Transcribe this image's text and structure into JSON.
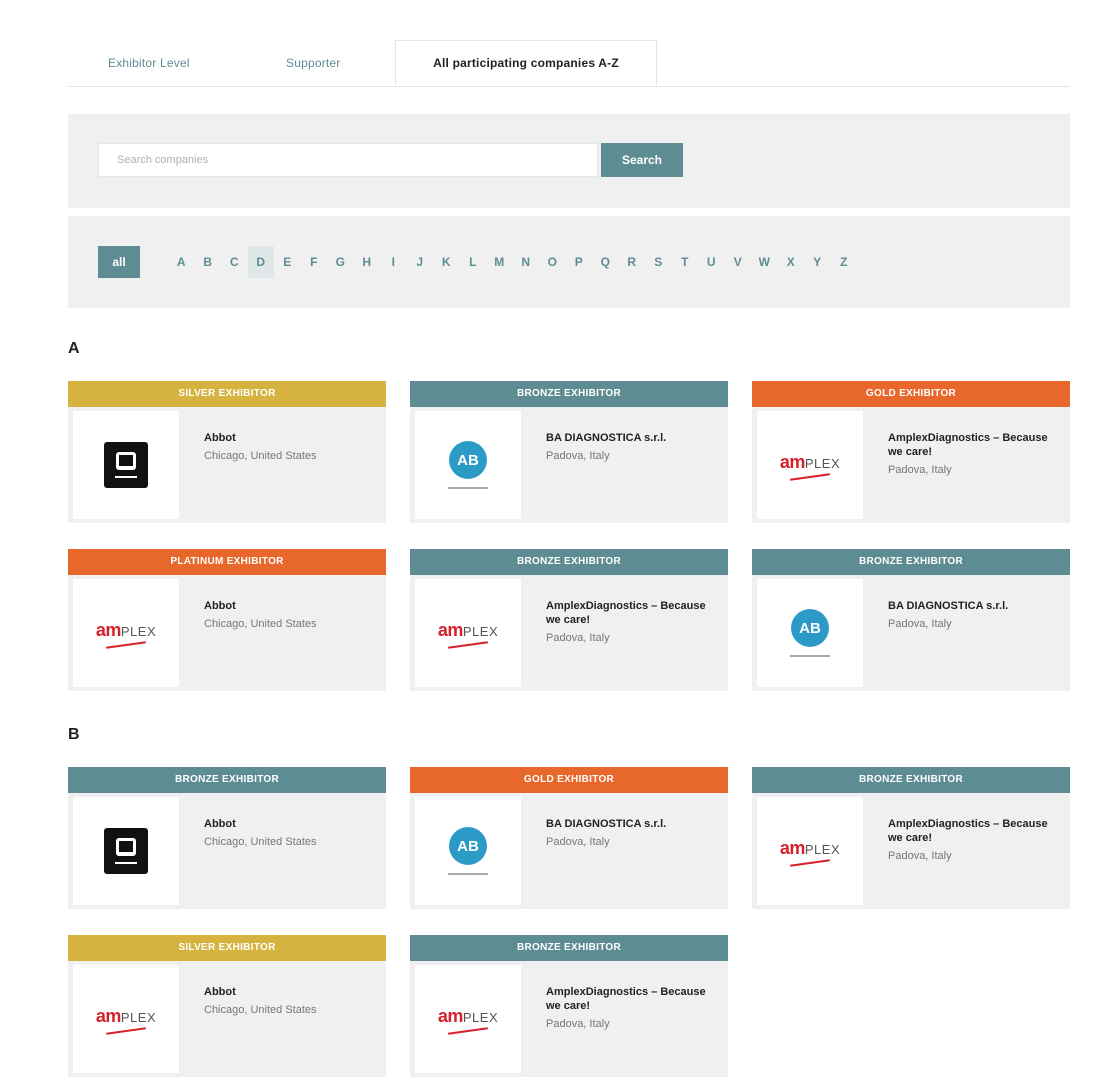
{
  "tabs": [
    {
      "label": "Exhibitor Level"
    },
    {
      "label": "Supporter"
    },
    {
      "label": "All participating companies A-Z"
    }
  ],
  "search": {
    "placeholder": "Search companies",
    "button_label": "Search"
  },
  "alphabet": {
    "all_label": "all",
    "letters": [
      "A",
      "B",
      "C",
      "D",
      "E",
      "F",
      "G",
      "H",
      "I",
      "J",
      "K",
      "L",
      "M",
      "N",
      "O",
      "P",
      "Q",
      "R",
      "S",
      "T",
      "U",
      "V",
      "W",
      "X",
      "Y",
      "Z"
    ],
    "selected": "D"
  },
  "sections": [
    {
      "letter": "A",
      "cards": [
        {
          "level": "SILVER EXHIBITOR",
          "name": "Abbot",
          "location": "Chicago, United States",
          "logo": "abbott-logo"
        },
        {
          "level": "BRONZE EXHIBITOR",
          "name": "BA DIAGNOSTICA s.r.l.",
          "location": "Padova, Italy",
          "logo": "ab-logo"
        },
        {
          "level": "GOLD EXHIBITOR",
          "name": "AmplexDiagnostics – Because we care!",
          "location": "Padova, Italy",
          "logo": "amplex-logo"
        },
        {
          "level": "PLATINUM EXHIBITOR",
          "name": "Abbot",
          "location": "Chicago, United States",
          "logo": "amplex-logo"
        },
        {
          "level": "BRONZE EXHIBITOR",
          "name": "AmplexDiagnostics – Because we care!",
          "location": "Padova, Italy",
          "logo": "amplex-logo"
        },
        {
          "level": "BRONZE EXHIBITOR",
          "name": "BA DIAGNOSTICA s.r.l.",
          "location": "Padova, Italy",
          "logo": "ab-logo"
        }
      ]
    },
    {
      "letter": "B",
      "cards": [
        {
          "level": "BRONZE EXHIBITOR",
          "name": "Abbot",
          "location": "Chicago, United States",
          "logo": "abbott-logo"
        },
        {
          "level": "GOLD EXHIBITOR",
          "name": "BA DIAGNOSTICA s.r.l.",
          "location": "Padova, Italy",
          "logo": "ab-logo"
        },
        {
          "level": "BRONZE EXHIBITOR",
          "name": "AmplexDiagnostics – Because we care!",
          "location": "Padova, Italy",
          "logo": "amplex-logo"
        },
        {
          "level": "SILVER EXHIBITOR",
          "name": "Abbot",
          "location": "Chicago, United States",
          "logo": "amplex-logo"
        },
        {
          "level": "BRONZE EXHIBITOR",
          "name": "AmplexDiagnostics – Because we care!",
          "location": "Padova, Italy",
          "logo": "amplex-logo"
        }
      ]
    }
  ],
  "colors": {
    "accent": "#5d8d93",
    "silver": "#d6b23f",
    "bronze": "#5d8d93",
    "gold": "#e8672a",
    "platinum": "#e8672a"
  }
}
